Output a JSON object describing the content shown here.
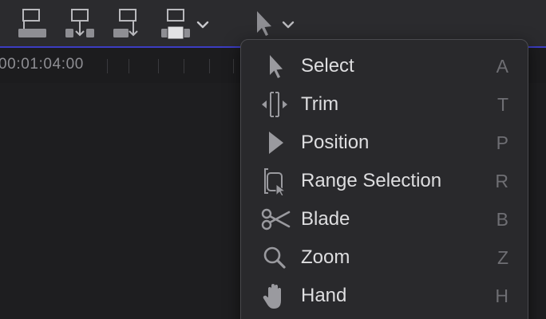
{
  "toolbar": {
    "buttons": [
      {
        "icon": "connect-clip-icon"
      },
      {
        "icon": "insert-clip-icon"
      },
      {
        "icon": "append-clip-icon"
      },
      {
        "icon": "overwrite-clip-icon"
      },
      {
        "icon": "select-tool-icon"
      }
    ]
  },
  "ruler": {
    "timecode": "00:01:04:00"
  },
  "tool_menu": {
    "items": [
      {
        "label": "Select",
        "shortcut": "A",
        "icon": "arrow-cursor-icon"
      },
      {
        "label": "Trim",
        "shortcut": "T",
        "icon": "trim-icon"
      },
      {
        "label": "Position",
        "shortcut": "P",
        "icon": "position-icon"
      },
      {
        "label": "Range Selection",
        "shortcut": "R",
        "icon": "range-selection-icon"
      },
      {
        "label": "Blade",
        "shortcut": "B",
        "icon": "scissors-icon"
      },
      {
        "label": "Zoom",
        "shortcut": "Z",
        "icon": "magnifier-icon"
      },
      {
        "label": "Hand",
        "shortcut": "H",
        "icon": "hand-icon"
      }
    ]
  },
  "colors": {
    "toolbar_bg": "#2b2b2e",
    "menu_bg": "#29292c",
    "accent_line": "#3c3dc2",
    "label_text": "#dedee0",
    "shortcut_text": "#6e6e73"
  }
}
